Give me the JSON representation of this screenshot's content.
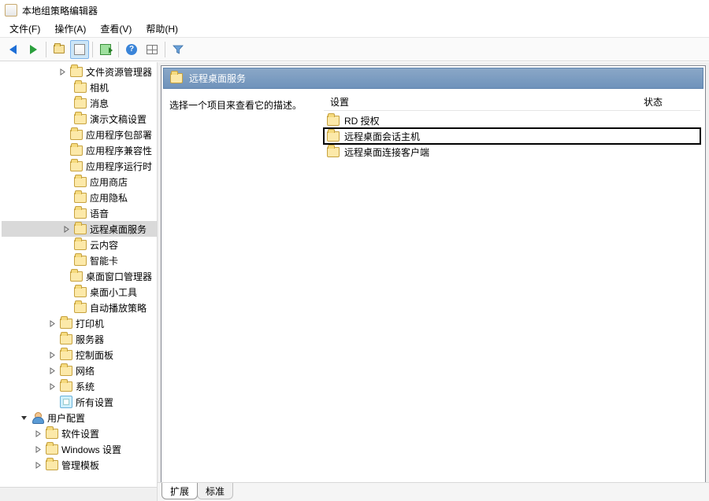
{
  "title": "本地组策略编辑器",
  "menubar": [
    "文件(F)",
    "操作(A)",
    "查看(V)",
    "帮助(H)"
  ],
  "toolbar": {
    "back": "back-arrow-icon",
    "forward": "forward-arrow-icon",
    "folder": "select-folder-icon",
    "props": "properties-icon",
    "export": "export-list-icon",
    "help": "help-icon",
    "table": "details-view-icon",
    "filter": "filter-icon"
  },
  "tree": [
    {
      "indent": 4,
      "exp": ">",
      "type": "folder",
      "label": "文件资源管理器"
    },
    {
      "indent": 4,
      "exp": "",
      "type": "folder",
      "label": "相机"
    },
    {
      "indent": 4,
      "exp": "",
      "type": "folder",
      "label": "消息"
    },
    {
      "indent": 4,
      "exp": "",
      "type": "folder",
      "label": "演示文稿设置"
    },
    {
      "indent": 4,
      "exp": "",
      "type": "folder",
      "label": "应用程序包部署"
    },
    {
      "indent": 4,
      "exp": "",
      "type": "folder",
      "label": "应用程序兼容性"
    },
    {
      "indent": 4,
      "exp": "",
      "type": "folder",
      "label": "应用程序运行时"
    },
    {
      "indent": 4,
      "exp": "",
      "type": "folder",
      "label": "应用商店"
    },
    {
      "indent": 4,
      "exp": "",
      "type": "folder",
      "label": "应用隐私"
    },
    {
      "indent": 4,
      "exp": "",
      "type": "folder",
      "label": "语音"
    },
    {
      "indent": 4,
      "exp": ">",
      "type": "folder",
      "label": "远程桌面服务",
      "selected": true
    },
    {
      "indent": 4,
      "exp": "",
      "type": "folder",
      "label": "云内容"
    },
    {
      "indent": 4,
      "exp": "",
      "type": "folder",
      "label": "智能卡"
    },
    {
      "indent": 4,
      "exp": "",
      "type": "folder",
      "label": "桌面窗口管理器"
    },
    {
      "indent": 4,
      "exp": "",
      "type": "folder",
      "label": "桌面小工具"
    },
    {
      "indent": 4,
      "exp": "",
      "type": "folder",
      "label": "自动播放策略"
    },
    {
      "indent": 3,
      "exp": ">",
      "type": "folder",
      "label": "打印机"
    },
    {
      "indent": 3,
      "exp": "",
      "type": "folder",
      "label": "服务器"
    },
    {
      "indent": 3,
      "exp": ">",
      "type": "folder",
      "label": "控制面板"
    },
    {
      "indent": 3,
      "exp": ">",
      "type": "folder",
      "label": "网络"
    },
    {
      "indent": 3,
      "exp": ">",
      "type": "folder",
      "label": "系统"
    },
    {
      "indent": 3,
      "exp": "",
      "type": "policy",
      "label": "所有设置"
    },
    {
      "indent": 1,
      "exp": "v",
      "type": "user",
      "label": "用户配置"
    },
    {
      "indent": 2,
      "exp": ">",
      "type": "folder",
      "label": "软件设置"
    },
    {
      "indent": 2,
      "exp": ">",
      "type": "folder",
      "label": "Windows 设置"
    },
    {
      "indent": 2,
      "exp": ">",
      "type": "folder",
      "label": "管理模板"
    }
  ],
  "content": {
    "header": "远程桌面服务",
    "description_prompt": "选择一个项目来查看它的描述。",
    "columns": {
      "setting": "设置",
      "state": "状态"
    },
    "items": [
      {
        "label": "RD 授权",
        "highlighted": false
      },
      {
        "label": "远程桌面会话主机",
        "highlighted": true
      },
      {
        "label": "远程桌面连接客户端",
        "highlighted": false
      }
    ],
    "tabs": {
      "extended": "扩展",
      "standard": "标准"
    }
  }
}
